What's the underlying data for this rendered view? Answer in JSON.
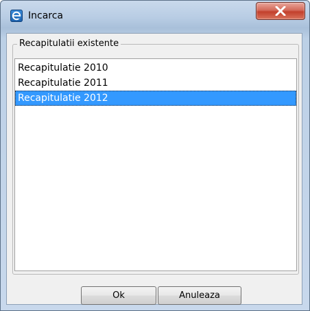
{
  "window": {
    "title": "Incarca",
    "app_icon": "app-e-icon",
    "close_icon": "close-x-icon"
  },
  "group": {
    "label": "Recapitulatii existente"
  },
  "list": {
    "items": [
      {
        "label": "Recapitulatie 2010",
        "selected": false
      },
      {
        "label": "Recapitulatie 2011",
        "selected": false
      },
      {
        "label": "Recapitulatie 2012",
        "selected": true
      }
    ]
  },
  "buttons": {
    "ok_label": "Ok",
    "cancel_label": "Anuleaza"
  },
  "colors": {
    "selection": "#3399ff",
    "close_button": "#c2402c"
  }
}
